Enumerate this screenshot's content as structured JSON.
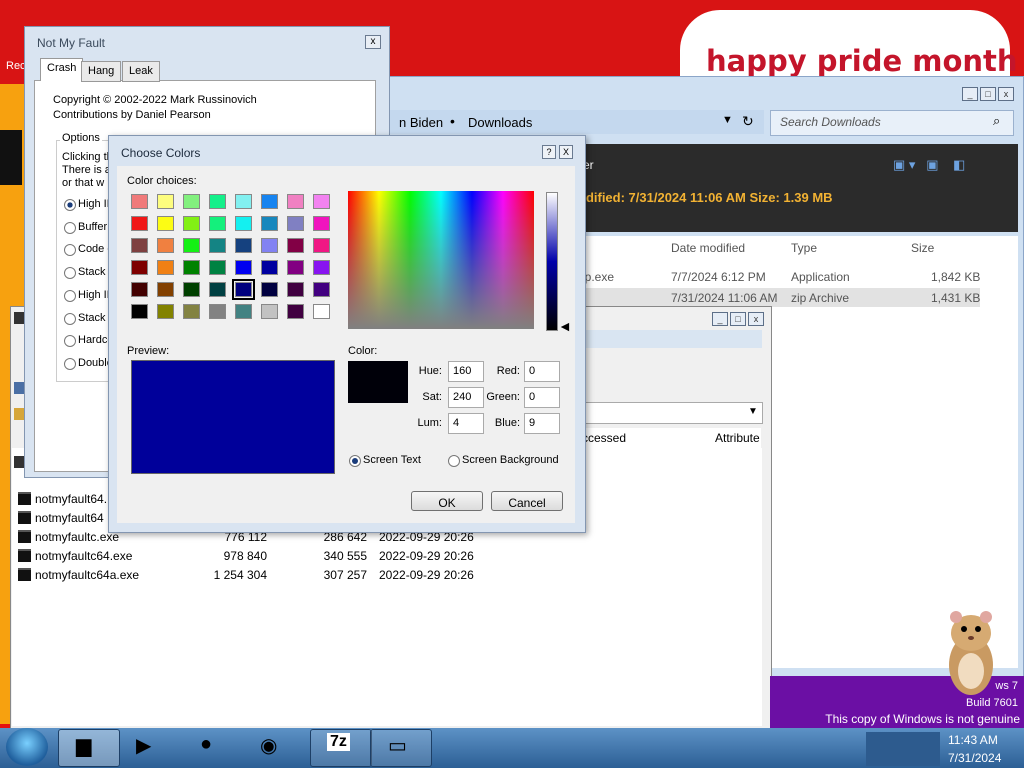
{
  "desktop": {
    "banner_text": "happy pride month",
    "left_edge_text": "Rec",
    "watermark": {
      "line1": "ws 7",
      "line2": "Build 7601",
      "line3": "This copy of Windows is not genuine"
    }
  },
  "explorer": {
    "breadcrumb": [
      "n Biden",
      "Downloads"
    ],
    "search_placeholder": "Search Downloads",
    "title_fragment": "er",
    "details_text": "odified: 7/31/2024 11:06 AM    Size: 1.39 MB",
    "columns": [
      "Date modified",
      "Type",
      "Size"
    ],
    "rows": [
      {
        "name": "up.exe",
        "date": "7/7/2024 6:12 PM",
        "type": "Application",
        "size": "1,842 KB"
      },
      {
        "name": "",
        "date": "7/31/2024 11:06 AM",
        "type": "zip Archive",
        "size": "1,431 KB"
      }
    ]
  },
  "sevenzip": {
    "columns": [
      "ccessed",
      "Attribute"
    ],
    "files": [
      {
        "name": "notmyfault64.",
        "size": "",
        "packed": "",
        "modified": ""
      },
      {
        "name": "notmyfault64",
        "size": "",
        "packed": "",
        "modified": ""
      },
      {
        "name": "notmyfaultc.exe",
        "size": "776 112",
        "packed": "286 642",
        "modified": "2022-09-29 20:26"
      },
      {
        "name": "notmyfaultc64.exe",
        "size": "978 840",
        "packed": "340 555",
        "modified": "2022-09-29 20:26"
      },
      {
        "name": "notmyfaultc64a.exe",
        "size": "1 254 304",
        "packed": "307 257",
        "modified": "2022-09-29 20:26"
      }
    ]
  },
  "notmyfault": {
    "title": "Not My Fault",
    "tabs": [
      "Crash",
      "Hang",
      "Leak"
    ],
    "copyright": "Copyright © 2002-2022 Mark Russinovich",
    "contributions": "Contributions by Daniel Pearson",
    "options_label": "Options",
    "options_lines": [
      "Clicking th",
      "There is a",
      "or that w"
    ],
    "radio_options": [
      "High IR",
      "Buffer",
      "Code o",
      "Stack",
      "High IR",
      "Stack",
      "Hardco",
      "Double"
    ]
  },
  "choose_colors": {
    "title": "Choose Colors",
    "help_label": "?",
    "close_label": "X",
    "color_choices_label": "Color choices:",
    "preview_label": "Preview:",
    "color_label": "Color:",
    "fields": {
      "hue_label": "Hue:",
      "hue": "160",
      "sat_label": "Sat:",
      "sat": "240",
      "lum_label": "Lum:",
      "lum": "4",
      "red_label": "Red:",
      "red": "0",
      "green_label": "Green:",
      "green": "0",
      "blue_label": "Blue:",
      "blue": "9"
    },
    "radio_screen_text": "Screen Text",
    "radio_screen_background": "Screen Background",
    "ok_label": "OK",
    "cancel_label": "Cancel",
    "swatches": [
      "#f07a7a",
      "#fdfd7e",
      "#82f07e",
      "#14f08a",
      "#82f0f0",
      "#1784f0",
      "#f080c2",
      "#f282f0",
      "#f01717",
      "#fcfc14",
      "#82f014",
      "#14f07c",
      "#14f0f0",
      "#1787bd",
      "#8080c2",
      "#f014be",
      "#7e4040",
      "#f08040",
      "#14f014",
      "#148484",
      "#15417f",
      "#8282f2",
      "#820045",
      "#f01784",
      "#7e0000",
      "#f08014",
      "#008200",
      "#008242",
      "#0000f0",
      "#0000a0",
      "#820082",
      "#8814f0",
      "#420000",
      "#824000",
      "#004000",
      "#004042",
      "#00007e",
      "#000040",
      "#400040",
      "#420080",
      "#000000",
      "#828200",
      "#828242",
      "#828282",
      "#428282",
      "#c2c2c2",
      "#400040",
      "#ffffff"
    ],
    "selected_swatch_index": 36,
    "preview_color": "#00009a",
    "current_color": "#000009"
  },
  "taskbar": {
    "clock_time": "11:43 AM",
    "clock_date": "7/31/2024",
    "app_icons": [
      "terminal-icon",
      "media-player-icon",
      "globe-icon",
      "firefox-icon",
      "7zip-icon",
      "screen-icon"
    ]
  }
}
